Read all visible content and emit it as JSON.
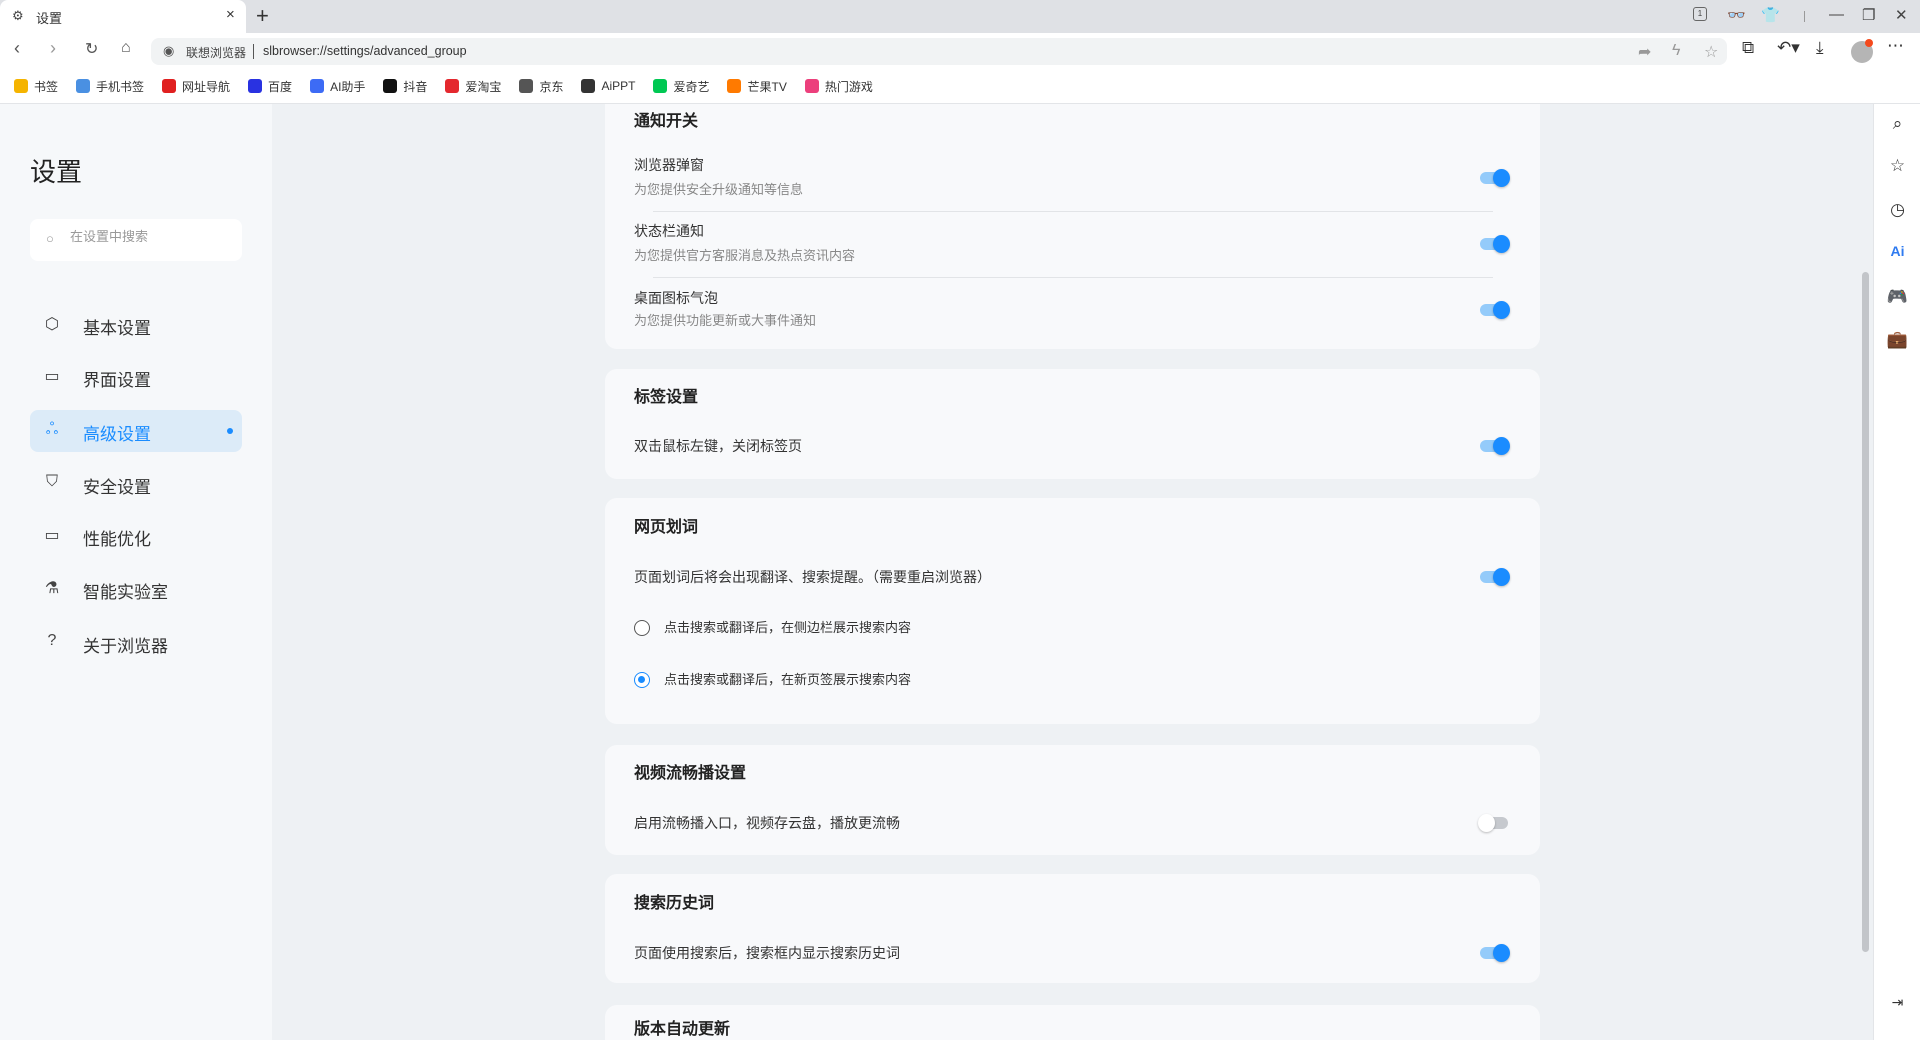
{
  "tab": {
    "title": "设置",
    "close": "×",
    "new": "+"
  },
  "window": {
    "tab_count": "1",
    "minimize": "—",
    "restore": "❐",
    "close": "✕"
  },
  "toolbar": {
    "brand": "联想浏览器",
    "url": "slbrowser://settings/advanced_group"
  },
  "bookmarks": [
    {
      "label": "书签",
      "color": "#f5b400"
    },
    {
      "label": "手机书签",
      "color": "#4a90e2"
    },
    {
      "label": "网址导航",
      "color": "#e02020"
    },
    {
      "label": "百度",
      "color": "#2932e1"
    },
    {
      "label": "AI助手",
      "color": "#3d6bf5"
    },
    {
      "label": "抖音",
      "color": "#111111"
    },
    {
      "label": "爱淘宝",
      "color": "#e4282e"
    },
    {
      "label": "京东",
      "color": "#555555"
    },
    {
      "label": "AiPPT",
      "color": "#333333"
    },
    {
      "label": "爱奇艺",
      "color": "#00c853"
    },
    {
      "label": "芒果TV",
      "color": "#ff7a00"
    },
    {
      "label": "热门游戏",
      "color": "#ec3f7c"
    }
  ],
  "sidebar": {
    "title": "设置",
    "search_placeholder": "在设置中搜索",
    "items": [
      {
        "label": "基本设置",
        "icon": "⬡"
      },
      {
        "label": "界面设置",
        "icon": "▭"
      },
      {
        "label": "高级设置",
        "icon": "ஃ"
      },
      {
        "label": "安全设置",
        "icon": "⛉"
      },
      {
        "label": "性能优化",
        "icon": "▭"
      },
      {
        "label": "智能实验室",
        "icon": "⚗"
      },
      {
        "label": "关于浏览器",
        "icon": "?"
      }
    ],
    "active_index": 2
  },
  "sections": {
    "notify": {
      "title": "通知开关",
      "items": [
        {
          "title": "浏览器弹窗",
          "desc": "为您提供安全升级通知等信息",
          "on": true
        },
        {
          "title": "状态栏通知",
          "desc": "为您提供官方客服消息及热点资讯内容",
          "on": true
        },
        {
          "title": "桌面图标气泡",
          "desc": "为您提供功能更新或大事件通知",
          "on": true
        }
      ]
    },
    "tabs": {
      "title": "标签设置",
      "item": "双击鼠标左键，关闭标签页",
      "on": true
    },
    "selection": {
      "title": "网页划词",
      "item": "页面划词后将会出现翻译、搜索提醒。（需要重启浏览器）",
      "on": true,
      "options": [
        "点击搜索或翻译后，在侧边栏展示搜索内容",
        "点击搜索或翻译后，在新页签展示搜索内容"
      ],
      "selected": 1
    },
    "video": {
      "title": "视频流畅播设置",
      "item": "启用流畅播入口，视频存云盘，播放更流畅",
      "on": false
    },
    "history": {
      "title": "搜索历史词",
      "item": "页面使用搜索后，搜索框内显示搜索历史词",
      "on": true
    },
    "update": {
      "title": "版本自动更新"
    }
  },
  "colors": {
    "accent": "#1a8cff"
  }
}
